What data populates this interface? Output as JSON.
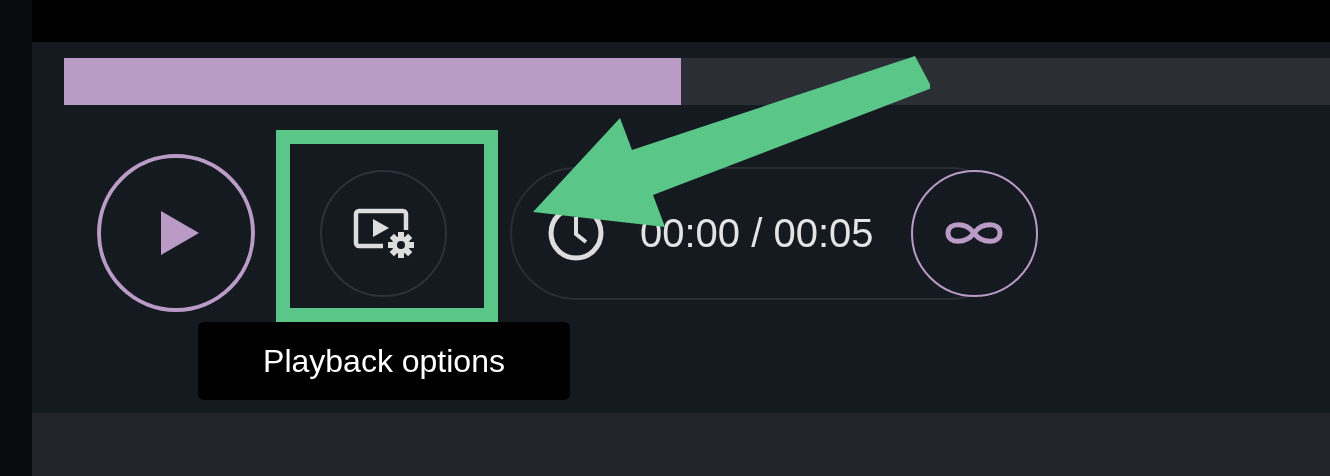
{
  "progress": {
    "level": 0.487
  },
  "controls": {
    "play_button": {
      "selected": false
    },
    "options_button": {
      "tooltip": "Playback options"
    },
    "time": "00:00 / 00:05",
    "loop_button": {
      "on": true
    }
  }
}
